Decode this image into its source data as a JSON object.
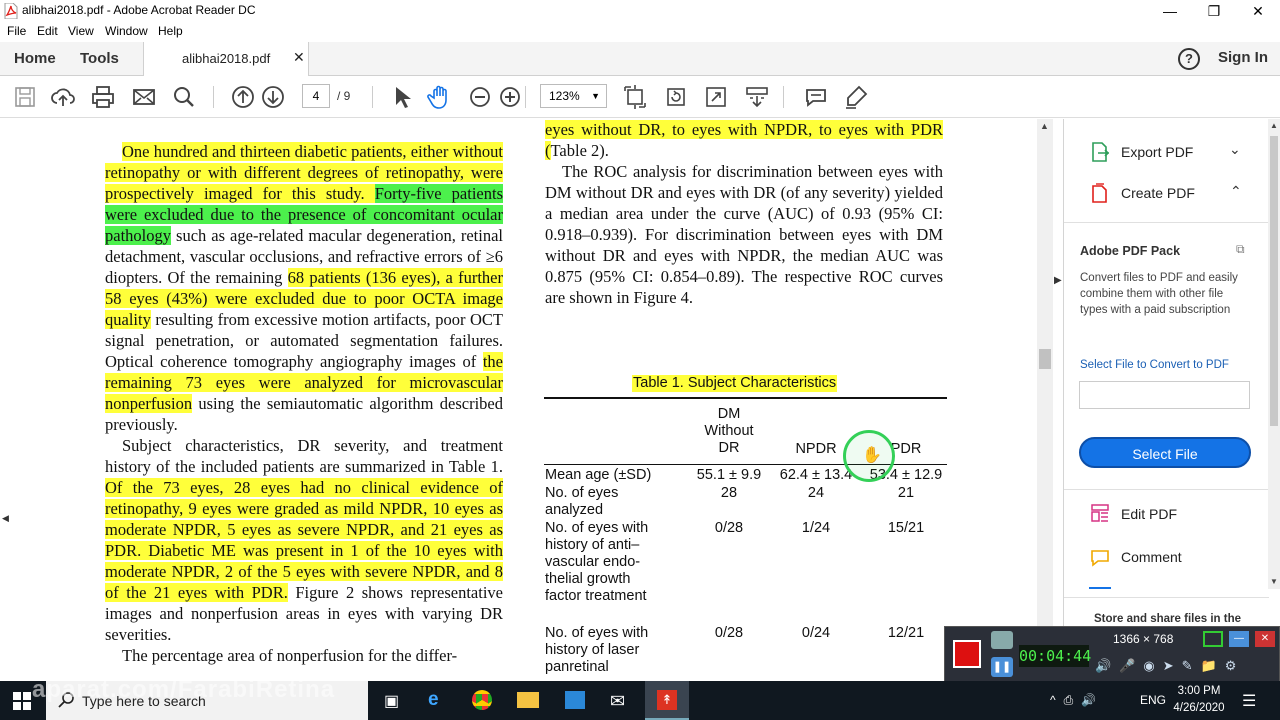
{
  "window": {
    "title": "alibhai2018.pdf - Adobe Acrobat Reader DC",
    "minimize": "—",
    "restore": "❐",
    "close": "✕"
  },
  "menu": [
    "File",
    "Edit",
    "View",
    "Window",
    "Help"
  ],
  "tabs": {
    "home": "Home",
    "tools": "Tools",
    "doc_tab": "alibhai2018.pdf",
    "doc_close": "✕",
    "help_icon": "?",
    "sign_in": "Sign In"
  },
  "toolbar": {
    "page_current": "4",
    "page_total": "/ 9",
    "zoom": "123%",
    "icons": [
      "save-icon",
      "cloud-upload-icon",
      "print-icon",
      "email-icon",
      "search-icon",
      "page-up-icon",
      "page-down-icon",
      "select-cursor-icon",
      "hand-icon",
      "zoom-out-icon",
      "zoom-in-icon",
      "fit-page-icon",
      "rotate-icon",
      "fullscreen-icon",
      "scroll-mode-icon",
      "comment-icon",
      "highlight-pen-icon"
    ]
  },
  "document": {
    "left_column": [
      [
        {
          "t": "One hundred and thirteen diabetic patients, either without retinopathy or with different degrees of retinopathy, were prospectively imaged for this study. ",
          "h": "y"
        },
        {
          "t": "Forty-five patients were excluded due to the presence of concomitant ocular pathology",
          "h": "g"
        },
        {
          "t": " such as age-related macular degeneration, retinal detachment, vascular occlusions, and refractive errors of ≥6 diopters. Of the remaining ",
          "h": ""
        },
        {
          "t": "68 patients (136 eyes), a further 58 eyes (43%) were excluded due to poor OCTA image quality",
          "h": "y"
        },
        {
          "t": " resulting from excessive motion artifacts, poor OCT signal penetration, or automated segmentation failures. Optical coherence tomography angiography images of ",
          "h": ""
        },
        {
          "t": "the remaining 73 eyes were analyzed for microvascular nonperfusion",
          "h": "y"
        },
        {
          "t": " using the semiautomatic algorithm described previously.",
          "h": ""
        }
      ],
      [
        {
          "t": "Subject characteristics, DR severity, and treatment history of the included patients are summarized in Table 1. ",
          "h": ""
        },
        {
          "t": "Of the 73 eyes, 28 eyes had no clinical evidence of retinopathy, 9 eyes were graded as mild NPDR, 10 eyes as moderate NPDR, 5 eyes as severe NPDR, and 21 eyes as PDR. Diabetic ME was present in 1 of the 10 eyes with moderate NPDR, 2 of the 5 eyes with severe NPDR, and 8 of the 21 eyes with PDR.",
          "h": "y"
        },
        {
          "t": " Figure 2 shows representative images and nonperfusion areas in eyes with varying DR severities.",
          "h": ""
        }
      ],
      [
        {
          "t": "The percentage area of nonperfusion for the differ-",
          "h": ""
        }
      ]
    ],
    "right_column": [
      [
        {
          "t": "eyes without DR, to eyes with NPDR, to eyes with PDR (",
          "h": "y"
        },
        {
          "t": "Table 2).",
          "h": ""
        }
      ],
      [
        {
          "t": "The ROC analysis for discrimination between eyes with DM without DR and eyes with DR (of any severity) yielded a median area under the curve (AUC) of 0.93 (95% CI: 0.918–0.939). For discrimination between eyes with DM without DR and eyes with NPDR, the median AUC was 0.875 (95% CI: 0.854–0.89). The respective ROC curves are shown in Figure 4.",
          "h": ""
        }
      ]
    ],
    "table": {
      "caption": "Table 1. Subject Characteristics",
      "headers": [
        "DM Without DR",
        "NPDR",
        "PDR"
      ],
      "rows": [
        {
          "label": "Mean age (±SD)",
          "values": [
            "55.1 ± 9.9",
            "62.4 ± 13.4",
            "53.4 ± 12.9"
          ]
        },
        {
          "label": "No. of eyes analyzed",
          "values": [
            "28",
            "24",
            "21"
          ]
        },
        {
          "label": "No. of eyes with history of anti– vascular endo- thelial growth factor treatment",
          "values": [
            "0/28",
            "1/24",
            "15/21"
          ]
        },
        {
          "label": "No. of eyes with history of laser panretinal",
          "values": [
            "0/28",
            "0/24",
            "12/21"
          ]
        }
      ]
    }
  },
  "right_pane": {
    "export_pdf": "Export PDF",
    "create_pdf": "Create PDF",
    "pack_title": "Adobe PDF Pack",
    "pack_desc": "Convert files to PDF and easily combine them with other file types with a paid subscription",
    "convert_label": "Select File to Convert to PDF",
    "select_file": "Select File",
    "edit_pdf": "Edit PDF",
    "comment": "Comment",
    "store_share": "Store and share files in the"
  },
  "recorder": {
    "resolution": "1366 × 768",
    "timer": "00:04:44"
  },
  "taskbar": {
    "search_placeholder": "Type here to search",
    "watermark": "aparat.com/FarabiRetina",
    "lang": "ENG",
    "time": "3:00 PM",
    "date": "4/26/2020"
  }
}
